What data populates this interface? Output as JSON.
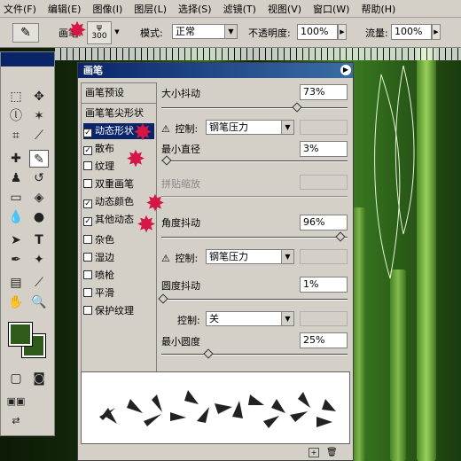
{
  "menu": [
    "文件(F)",
    "编辑(E)",
    "图像(I)",
    "图层(L)",
    "选择(S)",
    "滤镜(T)",
    "视图(V)",
    "窗口(W)",
    "帮助(H)"
  ],
  "options": {
    "brush_label": "画笔:",
    "brush_size": "300",
    "mode_label": "模式:",
    "mode_value": "正常",
    "opacity_label": "不透明度:",
    "opacity_value": "100%",
    "flow_label": "流量:",
    "flow_value": "100%"
  },
  "panel": {
    "title": "画笔",
    "presets_label": "画笔预设",
    "tip_shape_label": "画笔笔尖形状",
    "options": [
      {
        "label": "动态形状",
        "checked": true,
        "selected": true
      },
      {
        "label": "散布",
        "checked": true
      },
      {
        "label": "纹理",
        "checked": false
      },
      {
        "label": "双重画笔",
        "checked": false
      },
      {
        "label": "动态颜色",
        "checked": true
      },
      {
        "label": "其他动态",
        "checked": true
      },
      {
        "label": "杂色",
        "checked": false
      },
      {
        "label": "湿边",
        "checked": false
      },
      {
        "label": "喷枪",
        "checked": false
      },
      {
        "label": "平滑",
        "checked": false
      },
      {
        "label": "保护纹理",
        "checked": false
      }
    ],
    "size_jitter_label": "大小抖动",
    "size_jitter_value": "73%",
    "size_jitter_fraction": 0.73,
    "control_label": "控制:",
    "control1_value": "钢笔压力",
    "min_diameter_label": "最小直径",
    "min_diameter_value": "3%",
    "min_diameter_fraction": 0.03,
    "tilt_scale_label": "拼贴缩放",
    "angle_jitter_label": "角度抖动",
    "angle_jitter_value": "96%",
    "angle_jitter_fraction": 0.96,
    "control2_value": "钢笔压力",
    "roundness_jitter_label": "圆度抖动",
    "roundness_jitter_value": "1%",
    "roundness_jitter_fraction": 0.01,
    "control3_value": "关",
    "min_roundness_label": "最小圆度",
    "min_roundness_value": "25%",
    "min_roundness_fraction": 0.25
  },
  "colors": {
    "foreground": "#2e5a1a",
    "background": "#2e5a1a",
    "highlight": "#0a246a",
    "marker": "#d41747"
  }
}
